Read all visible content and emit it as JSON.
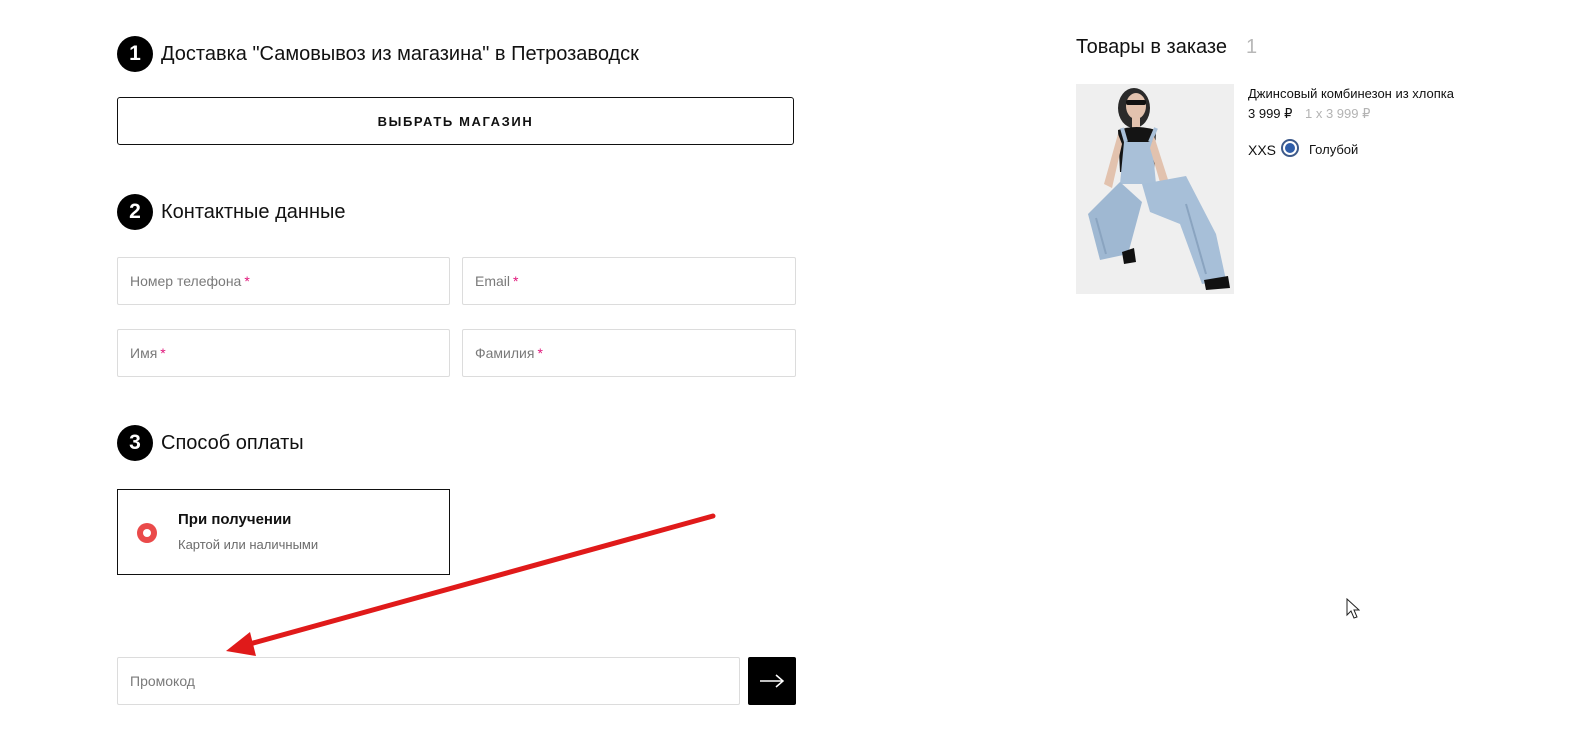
{
  "steps": [
    {
      "num": "1",
      "title": "Доставка \"Самовывоз из магазина\" в Петрозаводск"
    },
    {
      "num": "2",
      "title": "Контактные данные"
    },
    {
      "num": "3",
      "title": "Способ оплаты"
    }
  ],
  "delivery": {
    "choose_store_label": "ВЫБРАТЬ МАГАЗИН"
  },
  "contact": {
    "phone_placeholder": "Номер телефона",
    "email_placeholder": "Email",
    "first_name_placeholder": "Имя",
    "last_name_placeholder": "Фамилия",
    "required_mark": "*"
  },
  "payment": {
    "option_title": "При получении",
    "option_subtitle": "Картой или наличными",
    "selected": true
  },
  "promo": {
    "placeholder": "Промокод",
    "submit_icon": "arrow-right-icon"
  },
  "cart": {
    "title": "Товары в заказе",
    "count": "1",
    "items": [
      {
        "name": "Джинсовый комбинезон из хлопка",
        "price": "3 999 ₽",
        "qty_line": "1 x 3 999 ₽",
        "size": "XXS",
        "color_name": "Голубой",
        "color_hex": "#2f5da8"
      }
    ]
  },
  "colors": {
    "accent_radio": "#ea4a4a",
    "required": "#e0157a",
    "annotation_arrow": "#e01a1a"
  }
}
